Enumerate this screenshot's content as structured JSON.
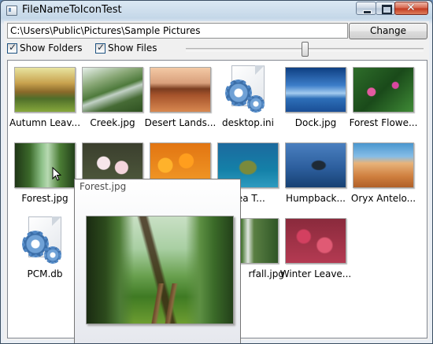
{
  "window": {
    "title": "FileNameToIconTest",
    "minimize_glyph": "",
    "close_glyph": "✕"
  },
  "toolbar": {
    "path_value": "C:\\Users\\Public\\Pictures\\Sample Pictures",
    "change_label": "Change",
    "show_folders_label": "Show Folders",
    "show_folders_checked": true,
    "show_files_label": "Show Files",
    "show_files_checked": true
  },
  "items": [
    {
      "name": "Autumn Leav...",
      "thumb": "autumn"
    },
    {
      "name": "Creek.jpg",
      "thumb": "creek"
    },
    {
      "name": "Desert Lands...",
      "thumb": "desert"
    },
    {
      "name": "desktop.ini",
      "thumb": "settings-file-icon"
    },
    {
      "name": "Dock.jpg",
      "thumb": "dock"
    },
    {
      "name": "Forest Flowe...",
      "thumb": "forestflower"
    },
    {
      "name": "Forest.jpg",
      "thumb": "forest"
    },
    {
      "name": "Sea T...",
      "thumb": "seaturtle"
    },
    {
      "name": "Humpback...",
      "thumb": "humpback"
    },
    {
      "name": "Oryx Antelo...",
      "thumb": "oryx"
    },
    {
      "name": "PCM.db",
      "thumb": "settings-file-icon"
    },
    {
      "name": "rfall.jpg",
      "thumb": "waterfall"
    },
    {
      "name": "Winter Leave...",
      "thumb": "winter"
    }
  ],
  "tooltip": {
    "title": "Forest.jpg"
  },
  "colors": {
    "accent": "#3b6ea8",
    "close_button": "#c2381f"
  }
}
